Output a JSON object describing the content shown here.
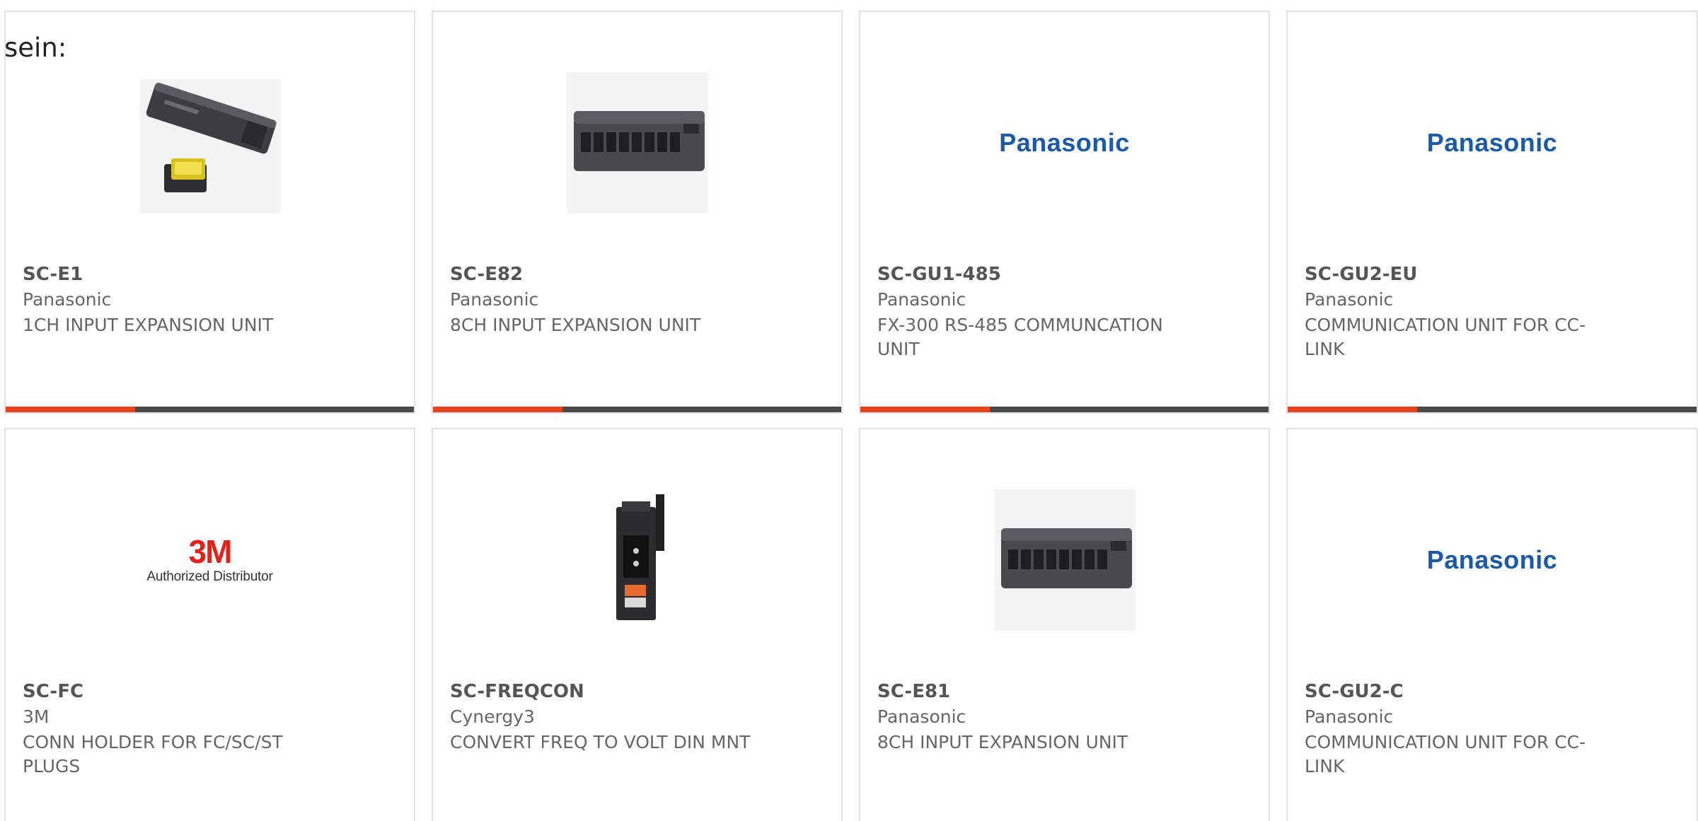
{
  "intro_text": "sein:",
  "accent_color": "#e8431a",
  "cards": [
    {
      "part": "SC-E1",
      "maker": "Panasonic",
      "description": "1CH INPUT EXPANSION UNIT",
      "image": "fiber-amplifier-photo",
      "show_bar": true
    },
    {
      "part": "SC-E82",
      "maker": "Panasonic",
      "description": "8CH INPUT EXPANSION UNIT",
      "image": "expansion-unit-photo",
      "show_bar": true
    },
    {
      "part": "SC-GU1-485",
      "maker": "Panasonic",
      "description": "FX-300 RS-485 COMMUNCATION UNIT",
      "image": "panasonic-logo",
      "logo_text": "Panasonic",
      "show_bar": true
    },
    {
      "part": "SC-GU2-EU",
      "maker": "Panasonic",
      "description": "COMMUNICATION UNIT FOR CC-LINK",
      "image": "panasonic-logo",
      "logo_text": "Panasonic",
      "show_bar": true
    },
    {
      "part": "SC-FC",
      "maker": "3M",
      "description": "CONN HOLDER FOR FC/SC/ST PLUGS",
      "image": "3m-logo",
      "logo_text": "3M",
      "logo_subtext": "Authorized Distributor",
      "show_bar": false
    },
    {
      "part": "SC-FREQCON",
      "maker": "Cynergy3",
      "description": "CONVERT FREQ TO VOLT DIN MNT",
      "image": "din-rail-module-photo",
      "show_bar": false
    },
    {
      "part": "SC-E81",
      "maker": "Panasonic",
      "description": "8CH INPUT EXPANSION UNIT",
      "image": "expansion-unit-photo",
      "show_bar": false
    },
    {
      "part": "SC-GU2-C",
      "maker": "Panasonic",
      "description": "COMMUNICATION UNIT FOR CC-LINK",
      "image": "panasonic-logo",
      "logo_text": "Panasonic",
      "show_bar": false
    }
  ]
}
